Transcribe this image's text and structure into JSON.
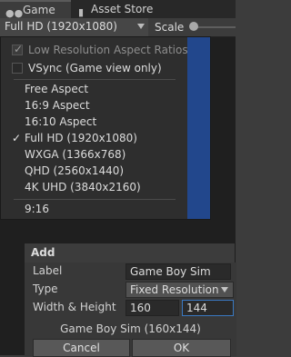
{
  "tabs": [
    {
      "label": "Game",
      "icon": "gamepad-icon"
    },
    {
      "label": "Asset Store",
      "icon": "shopping-bag-icon"
    }
  ],
  "toolbar": {
    "resolution_value": "Full HD (1920x1080)",
    "scale_label": "Scale"
  },
  "popup": {
    "low_res_label": "Low Resolution Aspect Ratios",
    "low_res_checked": true,
    "vsync_label": "VSync (Game view only)",
    "vsync_checked": false,
    "items": [
      {
        "label": "Free Aspect",
        "selected": false
      },
      {
        "label": "16:9 Aspect",
        "selected": false
      },
      {
        "label": "16:10 Aspect",
        "selected": false
      },
      {
        "label": "Full HD (1920x1080)",
        "selected": true
      },
      {
        "label": "WXGA (1366x768)",
        "selected": false
      },
      {
        "label": "QHD (2560x1440)",
        "selected": false
      },
      {
        "label": "4K UHD (3840x2160)",
        "selected": false
      },
      {
        "label": "9:16",
        "selected": false
      }
    ],
    "checkmark": "✓"
  },
  "add_dialog": {
    "title": "Add",
    "label_label": "Label",
    "label_value": "Game Boy Sim",
    "type_label": "Type",
    "type_value": "Fixed Resolution",
    "wh_label": "Width & Height",
    "width_value": "160",
    "height_value": "144",
    "summary": "Game Boy Sim (160x144)",
    "cancel_label": "Cancel",
    "ok_label": "OK"
  },
  "colors": {
    "selection_blue": "#22478c",
    "focus_outline": "#3a79c2"
  }
}
